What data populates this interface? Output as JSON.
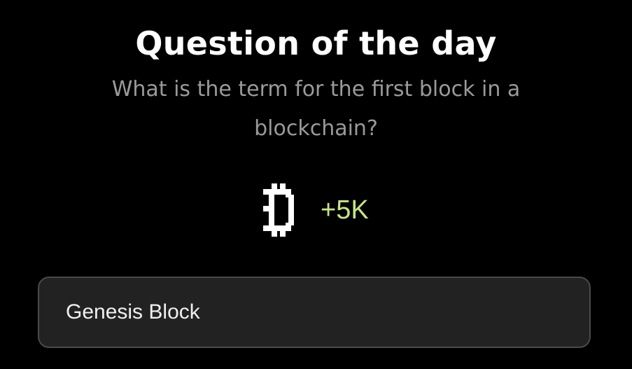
{
  "title": "Question of the day",
  "question": "What is the term for the first block in a blockchain?",
  "reward": {
    "icon": "bitcoin-pixel-icon",
    "value": "+5K",
    "color": "#c6e685"
  },
  "answer": {
    "value": "Genesis Block"
  }
}
